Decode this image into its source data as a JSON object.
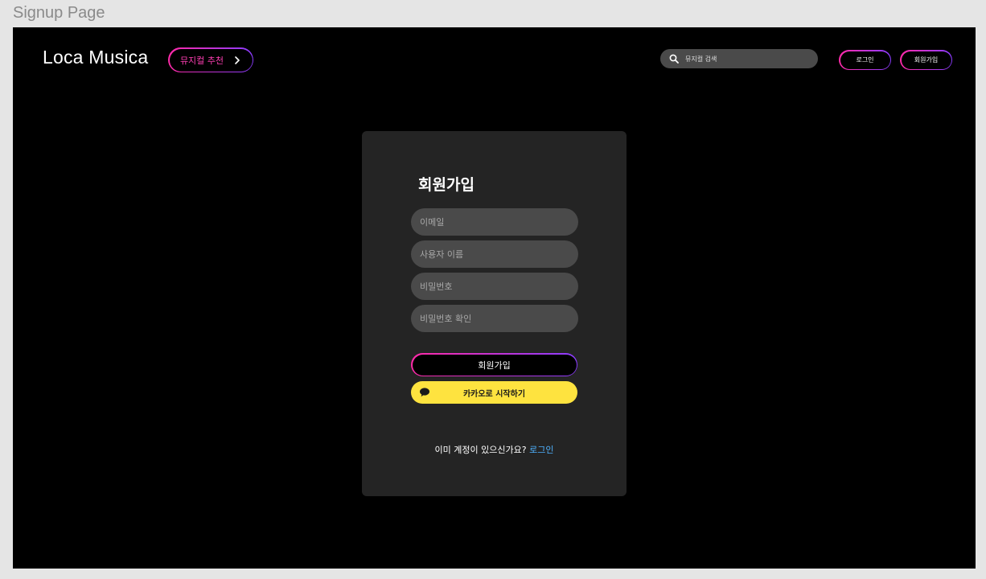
{
  "frame": {
    "label": "Signup Page"
  },
  "header": {
    "logo": "Loca Musica",
    "recommend_label": "뮤지컬 추천",
    "search_placeholder": "뮤지컬 검색",
    "login_label": "로그인",
    "signup_label": "회원가입"
  },
  "form": {
    "title": "회원가입",
    "email_placeholder": "이메일",
    "username_placeholder": "사용자 이름",
    "password_placeholder": "비밀번호",
    "password_confirm_placeholder": "비밀번호 확인",
    "submit_label": "회원가입",
    "kakao_label": "카카오로 시작하기",
    "has_account_text": "이미 계정이 있으신가요? ",
    "login_link": "로그인"
  },
  "colors": {
    "gradient_start": "#ff2aa8",
    "gradient_end": "#8a3cff",
    "kakao_yellow": "#fee33f",
    "link_blue": "#4fb2ff"
  },
  "icons": {
    "recommend": "chevron-right-icon",
    "search": "search-icon",
    "kakao": "speech-bubble-icon"
  }
}
